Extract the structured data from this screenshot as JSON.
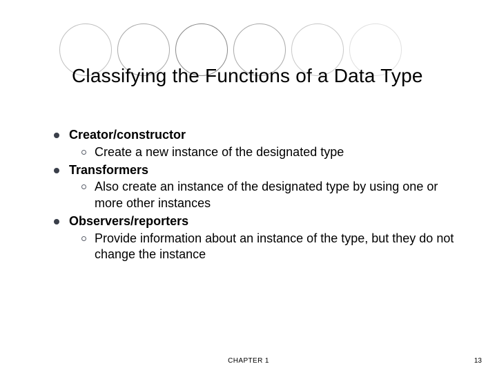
{
  "title": "Classifying the Functions of a Data Type",
  "items": [
    {
      "label": "Creator/constructor",
      "sub": "Create a new instance of the designated type"
    },
    {
      "label": "Transformers",
      "sub": "Also create an instance of the designated type by using one or more other instances"
    },
    {
      "label": "Observers/reporters",
      "sub": "Provide information about an instance of the type, but they do not change the instance"
    }
  ],
  "footer": {
    "chapter": "CHAPTER 1",
    "page": "13"
  }
}
